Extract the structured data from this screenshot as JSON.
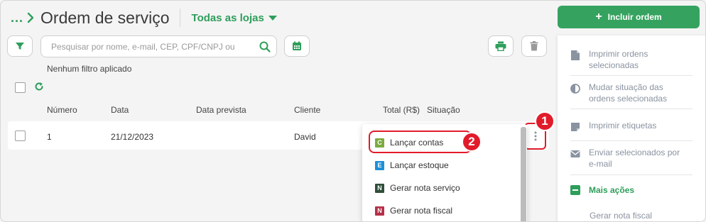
{
  "header": {
    "breadcrumb_dots": "...",
    "title": "Ordem de serviço",
    "store_selector": "Todas as lojas",
    "add_button": "Incluir ordem"
  },
  "toolbar": {
    "search_placeholder": "Pesquisar por nome, e-mail, CEP, CPF/CNPJ ou",
    "filter_status": "Nenhum filtro aplicado"
  },
  "table": {
    "columns": [
      "Número",
      "Data",
      "Data prevista",
      "Cliente",
      "Total (R$)",
      "Situação"
    ],
    "rows": [
      {
        "numero": "1",
        "data": "21/12/2023",
        "data_prevista": "",
        "cliente": "David",
        "total": "",
        "situacao": ""
      }
    ]
  },
  "dropdown": {
    "items": [
      {
        "letter": "C",
        "label": "Lançar contas",
        "color": "#7cab3e"
      },
      {
        "letter": "E",
        "label": "Lançar estoque",
        "color": "#1f8fd6"
      },
      {
        "letter": "N",
        "label": "Gerar nota serviço",
        "color": "#2f4f3a"
      },
      {
        "letter": "N",
        "label": "Gerar nota fiscal",
        "color": "#b63048"
      }
    ]
  },
  "side_panel": {
    "items": [
      {
        "icon": "document-icon",
        "label": "Imprimir ordens selecionadas"
      },
      {
        "icon": "half-circle-icon",
        "label": "Mudar situação das ordens selecionadas"
      },
      {
        "icon": "label-icon",
        "label": "Imprimir etiquetas"
      },
      {
        "icon": "envelope-icon",
        "label": "Enviar selecionados por e-mail"
      }
    ],
    "more_actions": "Mais ações",
    "sub_item": "Gerar nota fiscal"
  },
  "annotations": {
    "badge_1": "1",
    "badge_2": "2"
  },
  "colors": {
    "brand_green": "#35a35f",
    "highlight_red": "#e21b2a"
  }
}
